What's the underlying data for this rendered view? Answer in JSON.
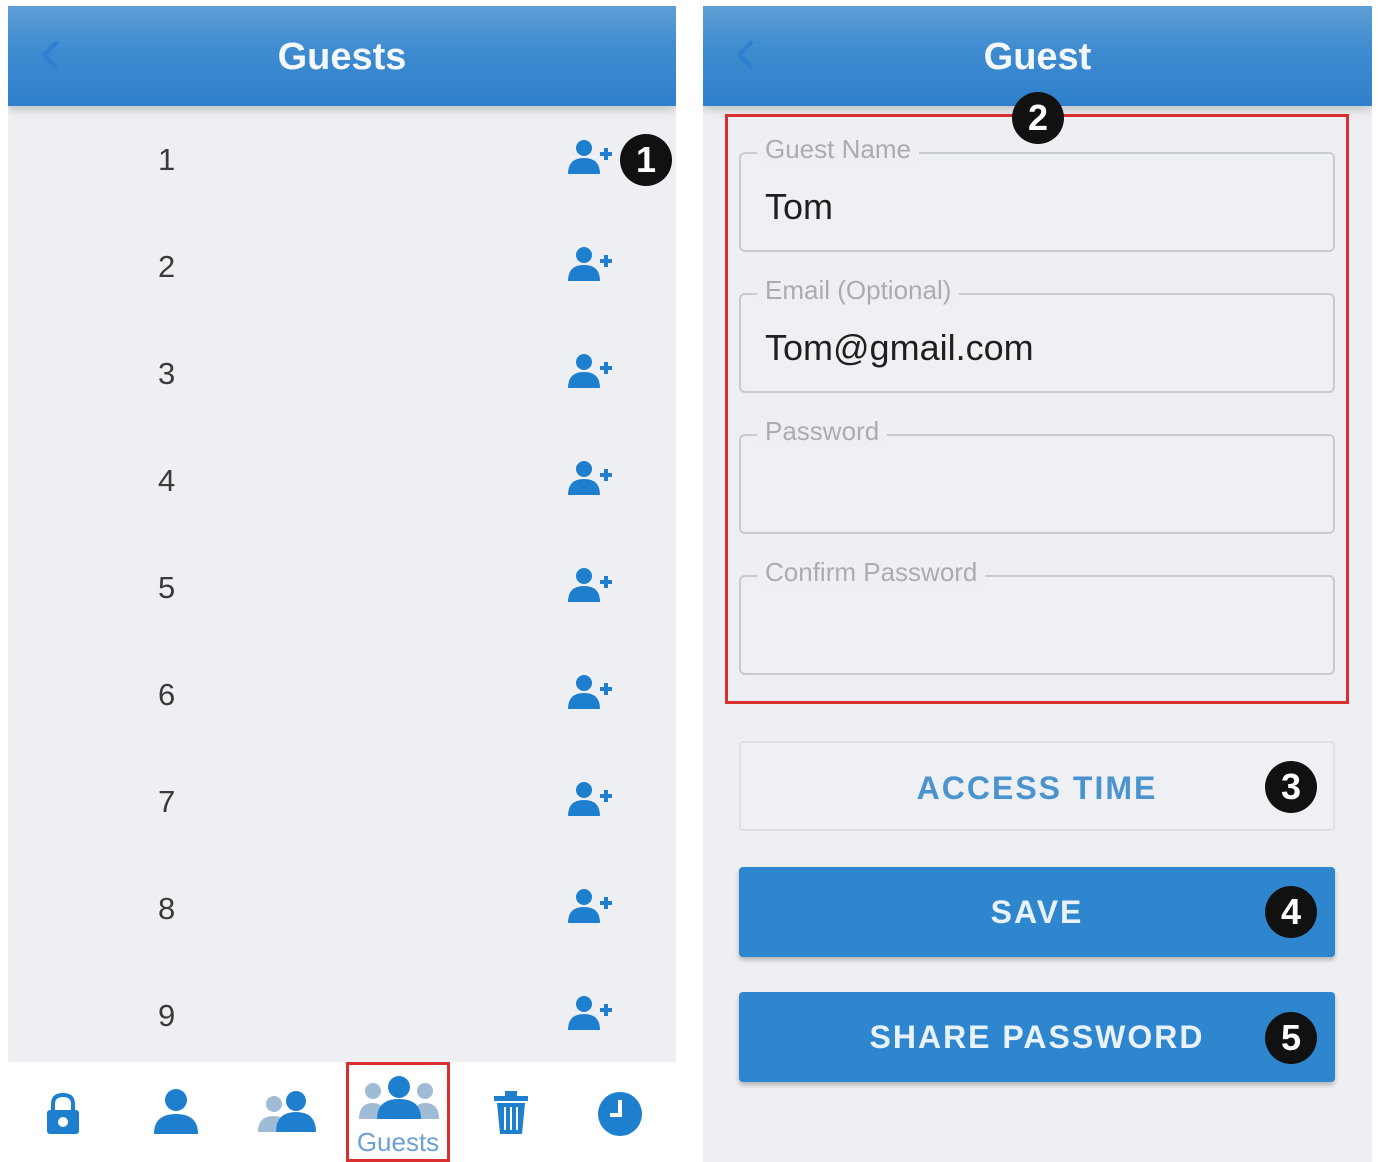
{
  "left_screen": {
    "title": "Guests",
    "guests": [
      "1",
      "2",
      "3",
      "4",
      "5",
      "6",
      "7",
      "8",
      "9"
    ],
    "bottom_nav": {
      "items": [
        {
          "icon": "lock-icon"
        },
        {
          "icon": "user-icon"
        },
        {
          "icon": "users-icon"
        },
        {
          "icon": "guests-icon",
          "label": "Guests",
          "active": true
        },
        {
          "icon": "trash-icon"
        },
        {
          "icon": "clock-icon"
        }
      ]
    }
  },
  "right_screen": {
    "title": "Guest",
    "fields": {
      "guest_name": {
        "label": "Guest Name",
        "value": "Tom"
      },
      "email": {
        "label": "Email (Optional)",
        "value": "Tom@gmail.com"
      },
      "password": {
        "label": "Password",
        "value": ""
      },
      "confirm_password": {
        "label": "Confirm Password",
        "value": ""
      }
    },
    "buttons": {
      "access_time": "ACCESS TIME",
      "save": "SAVE",
      "share_password": "SHARE PASSWORD"
    }
  },
  "callouts": [
    "1",
    "2",
    "3",
    "4",
    "5"
  ],
  "colors": {
    "header_blue": "#3d8bd0",
    "button_blue": "#2e86cf",
    "icon_blue": "#1e7fcf",
    "highlight_red": "#d9302f"
  }
}
